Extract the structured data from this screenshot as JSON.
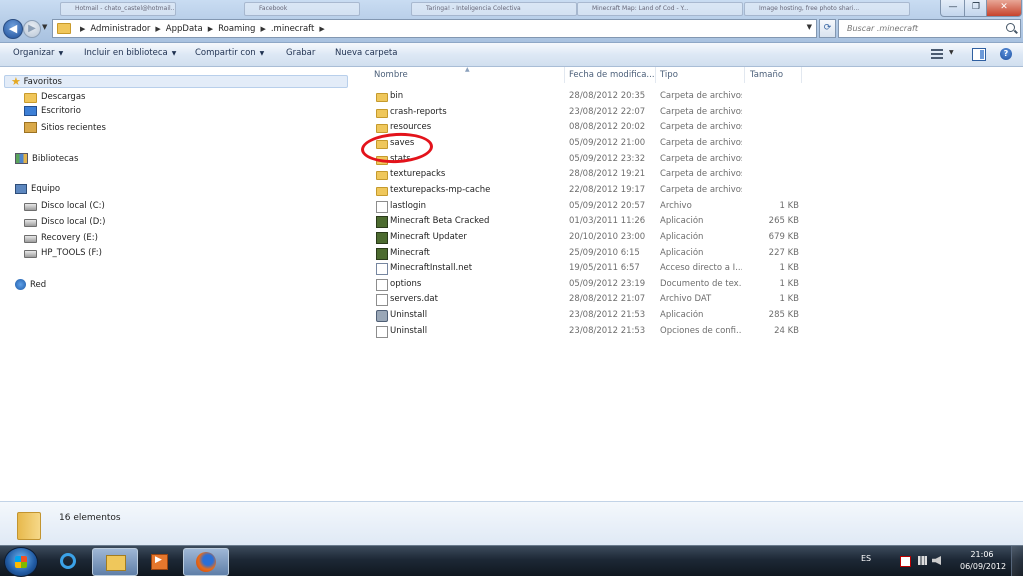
{
  "window": {
    "ghost_tabs": [
      "Hotmail - chato_castel@hotmail...",
      "Facebook",
      "Taringa! - Inteligencia Colectiva",
      "Minecraft Map: Land of Cod - Y...",
      "Image hosting, free photo shari..."
    ],
    "buttons": {
      "minimize": "—",
      "maximize": "❐",
      "close": "✕"
    }
  },
  "address": {
    "crumbs": [
      "Administrador",
      "AppData",
      "Roaming",
      ".minecraft"
    ],
    "search_placeholder": "Buscar .minecraft"
  },
  "commands": {
    "organize": "Organizar",
    "include_library": "Incluir en biblioteca",
    "share_with": "Compartir con",
    "burn": "Grabar",
    "new_folder": "Nueva carpeta"
  },
  "nav": {
    "favorites": "Favoritos",
    "downloads": "Descargas",
    "desktop": "Escritorio",
    "recent": "Sitios recientes",
    "libraries": "Bibliotecas",
    "computer": "Equipo",
    "drive_c": "Disco local (C:)",
    "drive_d": "Disco local (D:)",
    "drive_e": "Recovery (E:)",
    "drive_f": "HP_TOOLS (F:)",
    "network": "Red"
  },
  "columns": {
    "name": "Nombre",
    "date": "Fecha de modifica...",
    "type": "Tipo",
    "size": "Tamaño"
  },
  "files": [
    {
      "name": "bin",
      "date": "28/08/2012 20:35",
      "type": "Carpeta de archivos",
      "size": "",
      "icon": "folder"
    },
    {
      "name": "crash-reports",
      "date": "23/08/2012 22:07",
      "type": "Carpeta de archivos",
      "size": "",
      "icon": "folder"
    },
    {
      "name": "resources",
      "date": "08/08/2012 20:02",
      "type": "Carpeta de archivos",
      "size": "",
      "icon": "folder"
    },
    {
      "name": "saves",
      "date": "05/09/2012 21:00",
      "type": "Carpeta de archivos",
      "size": "",
      "icon": "folder"
    },
    {
      "name": "stats",
      "date": "05/09/2012 23:32",
      "type": "Carpeta de archivos",
      "size": "",
      "icon": "folder"
    },
    {
      "name": "texturepacks",
      "date": "28/08/2012 19:21",
      "type": "Carpeta de archivos",
      "size": "",
      "icon": "folder"
    },
    {
      "name": "texturepacks-mp-cache",
      "date": "22/08/2012 19:17",
      "type": "Carpeta de archivos",
      "size": "",
      "icon": "folder"
    },
    {
      "name": "lastlogin",
      "date": "05/09/2012 20:57",
      "type": "Archivo",
      "size": "1 KB",
      "icon": "document"
    },
    {
      "name": "Minecraft Beta Cracked",
      "date": "01/03/2011 11:26",
      "type": "Aplicación",
      "size": "265 KB",
      "icon": "application"
    },
    {
      "name": "Minecraft Updater",
      "date": "20/10/2010 23:00",
      "type": "Aplicación",
      "size": "679 KB",
      "icon": "application"
    },
    {
      "name": "Minecraft",
      "date": "25/09/2010 6:15",
      "type": "Aplicación",
      "size": "227 KB",
      "icon": "application"
    },
    {
      "name": "MinecraftInstall.net",
      "date": "19/05/2011 6:57",
      "type": "Acceso directo a I...",
      "size": "1 KB",
      "icon": "shortcut"
    },
    {
      "name": "options",
      "date": "05/09/2012 23:19",
      "type": "Documento de tex...",
      "size": "1 KB",
      "icon": "document"
    },
    {
      "name": "servers.dat",
      "date": "28/08/2012 21:07",
      "type": "Archivo DAT",
      "size": "1 KB",
      "icon": "document"
    },
    {
      "name": "Uninstall",
      "date": "23/08/2012 21:53",
      "type": "Aplicación",
      "size": "285 KB",
      "icon": "setup"
    },
    {
      "name": "Uninstall",
      "date": "23/08/2012 21:53",
      "type": "Opciones de confi...",
      "size": "24 KB",
      "icon": "document"
    }
  ],
  "details": {
    "count": "16 elementos"
  },
  "taskbar": {
    "lang": "ES",
    "time": "21:06",
    "date": "06/09/2012"
  },
  "colors": {
    "annotation_circle": "#e3131b",
    "accent": "#1d4f9f"
  }
}
